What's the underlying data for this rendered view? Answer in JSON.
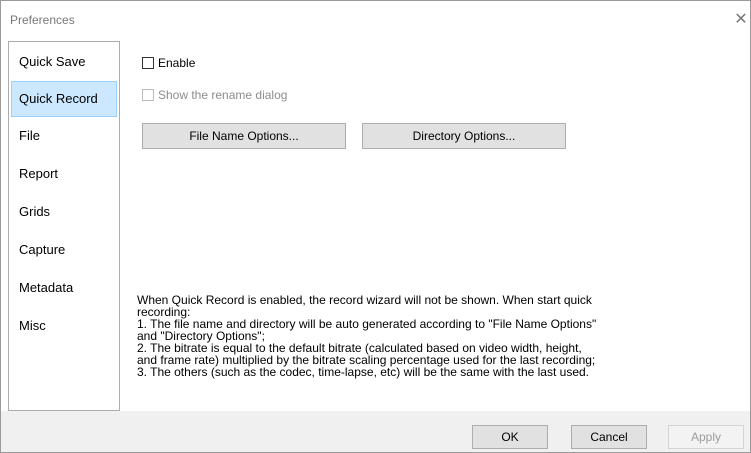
{
  "window": {
    "title": "Preferences",
    "close_glyph": "✕"
  },
  "nav": {
    "items": [
      {
        "label": "Quick Save"
      },
      {
        "label": "Quick Record"
      },
      {
        "label": "File"
      },
      {
        "label": "Report"
      },
      {
        "label": "Grids"
      },
      {
        "label": "Capture"
      },
      {
        "label": "Metadata"
      },
      {
        "label": "Misc"
      }
    ],
    "selected": "Quick Record"
  },
  "content": {
    "enable_label": "Enable",
    "enable_checked": false,
    "rename_label": "Show the rename dialog",
    "rename_checked": false,
    "rename_enabled": false,
    "file_name_button": "File Name Options...",
    "directory_button": "Directory Options...",
    "description_lines": [
      "When Quick Record is enabled, the record wizard will not be shown. When start quick",
      "recording:",
      "1. The file name and directory will be auto generated according to \"File Name Options\"",
      "and \"Directory Options\";",
      "2. The bitrate is equal to the default bitrate (calculated based on video width, height,",
      "and frame rate) multiplied by the bitrate scaling percentage used for the last recording;",
      "3. The others (such as the codec, time-lapse, etc) will be the same with the last used."
    ]
  },
  "footer": {
    "ok_label": "OK",
    "cancel_label": "Cancel",
    "apply_label": "Apply",
    "apply_enabled": false
  }
}
